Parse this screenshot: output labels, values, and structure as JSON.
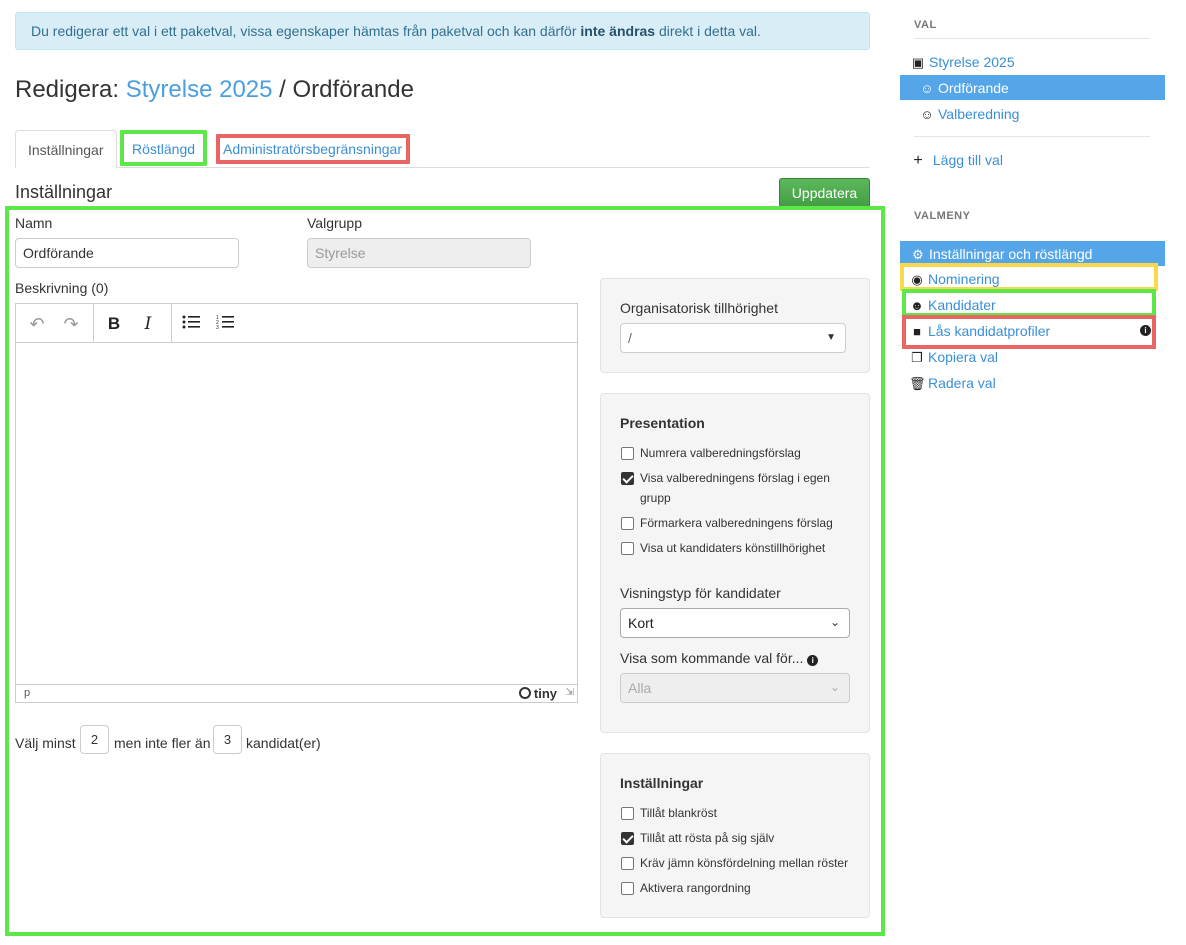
{
  "alert": {
    "text_before": "Du redigerar ett val i ett paketval, vissa egenskaper hämtas från paketval och kan därför ",
    "text_bold": "inte ändras",
    "text_after": " direkt i detta val."
  },
  "title": {
    "prefix": "Redigera: ",
    "package_link": "Styrelse 2025",
    "separator": " / ",
    "election": "Ordförande"
  },
  "tabs": [
    {
      "label": "Inställningar"
    },
    {
      "label": "Röstlängd"
    },
    {
      "label": "Administratörsbegränsningar"
    }
  ],
  "section_title": "Inställningar",
  "update_button": "Uppdatera",
  "form": {
    "name_label": "Namn",
    "name_value": "Ordförande",
    "group_label": "Valgrupp",
    "group_value": "Styrelse",
    "description_label": "Beskrivning (0)",
    "editor_status_path": "p",
    "editor_brand": "tiny",
    "choose_min_label": "Välj minst",
    "choose_min_value": "2",
    "choose_max_label": "men inte fler än",
    "choose_max_value": "3",
    "choose_suffix": "kandidat(er)"
  },
  "org_panel": {
    "label": "Organisatorisk tillhörighet",
    "value": "/"
  },
  "presentation_panel": {
    "title": "Presentation",
    "options": [
      {
        "label": "Numrera valberedningsförslag",
        "checked": false
      },
      {
        "label": "Visa valberedningens förslag i egen",
        "label2": "grupp",
        "checked": true
      },
      {
        "label": "Förmarkera valberedningens förslag",
        "checked": false
      },
      {
        "label": "Visa ut kandidaters könstillhörighet",
        "checked": false
      }
    ],
    "display_type_label": "Visningstyp för kandidater",
    "display_type_value": "Kort",
    "upcoming_label": "Visa som kommande val för...",
    "upcoming_value": "Alla"
  },
  "settings_panel": {
    "title": "Inställningar",
    "options": [
      {
        "label": "Tillåt blankröst",
        "checked": false
      },
      {
        "label": "Tillåt att rösta på sig själv",
        "checked": true
      },
      {
        "label": "Kräv jämn könsfördelning mellan röster",
        "checked": false
      },
      {
        "label": "Aktivera rangordning",
        "checked": false
      }
    ]
  },
  "sidebar": {
    "val_header": "VAL",
    "val_items": [
      {
        "label": "Styrelse 2025",
        "icon": "boxes-icon"
      },
      {
        "label": "Ordförande",
        "icon": "user-group-icon"
      },
      {
        "label": "Valberedning",
        "icon": "user-group-icon"
      }
    ],
    "add_label": "Lägg till val",
    "menu_header": "VALMENY",
    "menu_items": [
      {
        "label": "Inställningar och röstlängd",
        "icon": "gear-icon"
      },
      {
        "label": "Nominering",
        "icon": "comment-plus-icon"
      },
      {
        "label": "Kandidater",
        "icon": "users-icon"
      },
      {
        "label": "Lås kandidatprofiler",
        "icon": "lock-icon"
      },
      {
        "label": "Kopiera val",
        "icon": "copy-icon"
      },
      {
        "label": "Radera val",
        "icon": "trash-icon"
      }
    ]
  },
  "colors": {
    "highlight_green": "#5de84a",
    "highlight_red": "#e96563",
    "highlight_yellow": "#f9d949",
    "active_blue": "#55a6e9"
  }
}
